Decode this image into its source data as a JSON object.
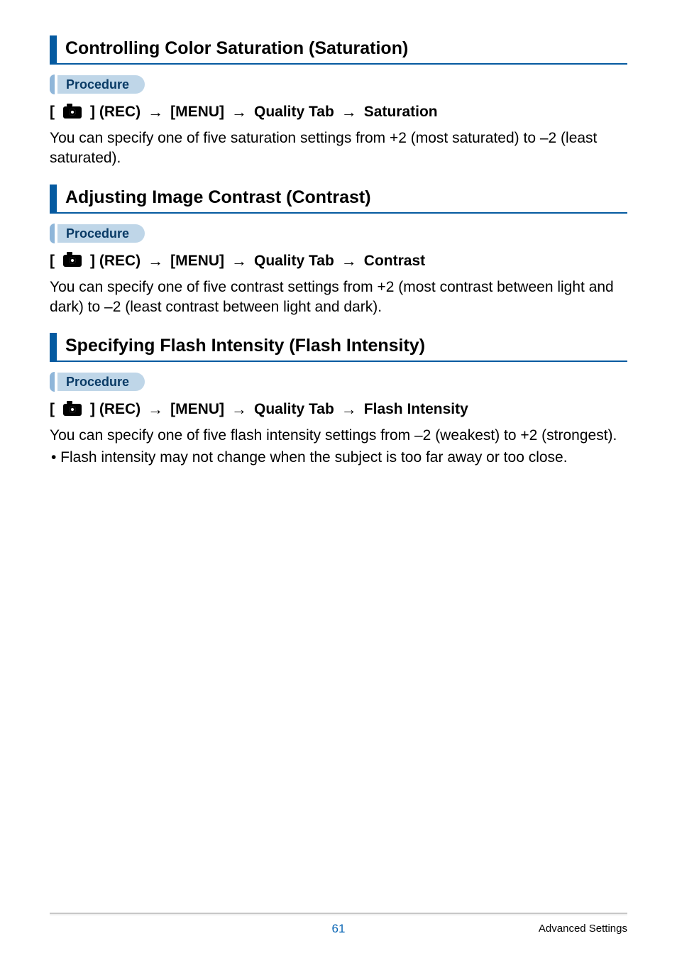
{
  "sections": [
    {
      "title": "Controlling Color Saturation (Saturation)",
      "procedure_label": "Procedure",
      "step_prefix": "[",
      "step_rec": "] (REC)",
      "step_menu": "[MENU]",
      "step_tab": "Quality Tab",
      "step_item": "Saturation",
      "body": "You can specify one of five saturation settings from +2 (most saturated) to –2 (least saturated).",
      "bullet": null
    },
    {
      "title": "Adjusting Image Contrast (Contrast)",
      "procedure_label": "Procedure",
      "step_prefix": "[",
      "step_rec": "] (REC)",
      "step_menu": "[MENU]",
      "step_tab": "Quality Tab",
      "step_item": "Contrast",
      "body": "You can specify one of five contrast settings from +2 (most contrast between light and dark) to –2 (least contrast between light and dark).",
      "bullet": null
    },
    {
      "title": "Specifying Flash Intensity (Flash Intensity)",
      "procedure_label": "Procedure",
      "step_prefix": "[",
      "step_rec": "] (REC)",
      "step_menu": "[MENU]",
      "step_tab": "Quality Tab",
      "step_item": "Flash Intensity",
      "body": "You can specify one of five flash intensity settings from –2 (weakest) to +2 (strongest).",
      "bullet": "• Flash intensity may not change when the subject is too far away or too close."
    }
  ],
  "footer": {
    "page_number": "61",
    "section_label": "Advanced Settings"
  },
  "glyphs": {
    "arrow": "→"
  }
}
